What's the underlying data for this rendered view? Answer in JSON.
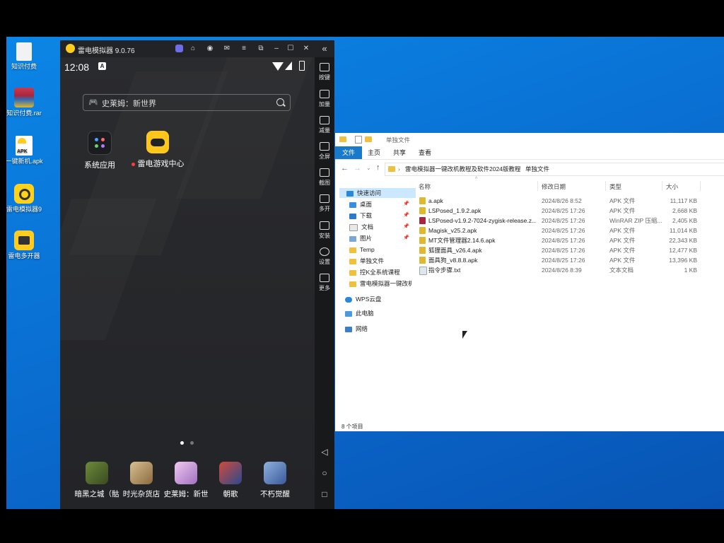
{
  "desktop": {
    "icons": [
      {
        "label": "知识付费",
        "icon": "file-icon",
        "color": "#f2f2f2"
      },
      {
        "label": "知识付费.rar",
        "icon": "winrar-archive-icon",
        "color": "#a9263e"
      },
      {
        "label": "一键新机.apk",
        "icon": "apk-file-icon",
        "color": "#ffffff"
      },
      {
        "label": "雷电模拟器9",
        "icon": "ldplayer-icon",
        "color": "#ffd21c"
      },
      {
        "label": "雷电多开器",
        "icon": "ldmulti-icon",
        "color": "#ffcc1f"
      }
    ]
  },
  "emulator": {
    "title": "雷电模拟器 9.0.76",
    "time": "12:08",
    "status_badge": "A",
    "search_placeholder": "史莱姆：新世界",
    "home_apps": [
      {
        "label": "系统应用",
        "icon": "system-apps-icon"
      },
      {
        "label": "雷电游戏中心",
        "icon": "game-center-icon"
      }
    ],
    "dock_apps": [
      {
        "label": "暗黑之城（骷",
        "color": "#6d8a3a"
      },
      {
        "label": "时光杂货店",
        "color": "#b8a070"
      },
      {
        "label": "史莱姆：新世",
        "color": "#c8a0d8"
      },
      {
        "label": "朝歌",
        "color": "#4a6fb0"
      },
      {
        "label": "不朽觉醒",
        "color": "#5a7fc0"
      }
    ],
    "sidebar": [
      {
        "label": "按键"
      },
      {
        "label": "加量"
      },
      {
        "label": "减量"
      },
      {
        "label": "全屏"
      },
      {
        "label": "截图"
      },
      {
        "label": "多开"
      },
      {
        "label": "安装"
      },
      {
        "label": "设置"
      },
      {
        "label": "更多"
      }
    ],
    "collapse_glyph": "«"
  },
  "explorer": {
    "title": "单独文件",
    "tabs": [
      "文件",
      "主页",
      "共享",
      "查看"
    ],
    "breadcrumb": [
      "雷电模拟器一键改机教程及软件2024版教程",
      "单独文件"
    ],
    "nav": {
      "quick_access": "快速访问",
      "items": [
        "桌面",
        "下载",
        "文档",
        "图片",
        "Temp",
        "单独文件",
        "控K全系统课程",
        "雷电模拟器一键改机"
      ],
      "wps": "WPS云盘",
      "this_pc": "此电脑",
      "network": "网络"
    },
    "columns": [
      "名称",
      "修改日期",
      "类型",
      "大小"
    ],
    "files": [
      {
        "name": "a.apk",
        "date": "2024/8/26 8:52",
        "type": "APK 文件",
        "size": "11,117 KB",
        "icon_color": "#e0b830"
      },
      {
        "name": "LSPosed_1.9.2.apk",
        "date": "2024/8/25 17:26",
        "type": "APK 文件",
        "size": "2,668 KB",
        "icon_color": "#e0b830"
      },
      {
        "name": "LSPosed-v1.9.2-7024-zygisk-release.z...",
        "date": "2024/8/25 17:26",
        "type": "WinRAR ZIP 压缩...",
        "size": "2,405 KB",
        "icon_color": "#a9263e"
      },
      {
        "name": "Magisk_v25.2.apk",
        "date": "2024/8/25 17:26",
        "type": "APK 文件",
        "size": "11,014 KB",
        "icon_color": "#e0b830"
      },
      {
        "name": "MT文件管理器2.14.6.apk",
        "date": "2024/8/25 17:26",
        "type": "APK 文件",
        "size": "22,343 KB",
        "icon_color": "#e0b830"
      },
      {
        "name": "狐狸面具_v26.4.apk",
        "date": "2024/8/25 17:26",
        "type": "APK 文件",
        "size": "12,477 KB",
        "icon_color": "#e0b830"
      },
      {
        "name": "面具狗_v8.8.8.apk",
        "date": "2024/8/25 17:26",
        "type": "APK 文件",
        "size": "13,396 KB",
        "icon_color": "#e0b830"
      },
      {
        "name": "指令步骤.txt",
        "date": "2024/8/26 8:39",
        "type": "文本文档",
        "size": "1 KB",
        "icon_color": "#dfe6ee"
      }
    ],
    "status": "8 个项目"
  }
}
